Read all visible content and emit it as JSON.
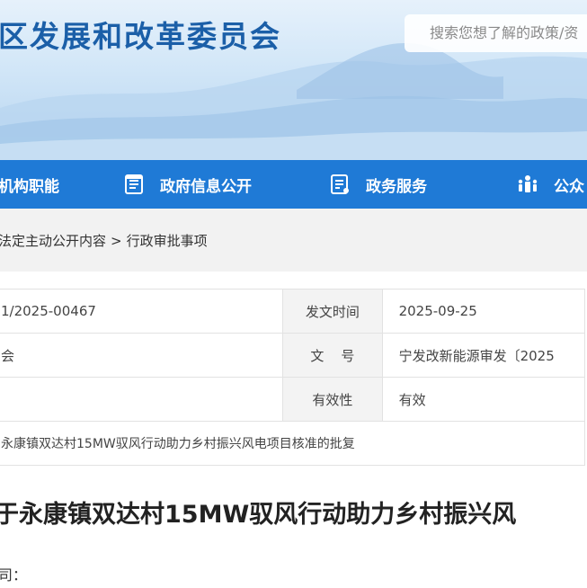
{
  "header": {
    "site_title": "区发展和改革委员会",
    "search_placeholder": "搜索您想了解的政策/资"
  },
  "nav": {
    "items": [
      {
        "label": "机构职能",
        "icon": "building-icon"
      },
      {
        "label": "政府信息公开",
        "icon": "document-list-icon"
      },
      {
        "label": "政务服务",
        "icon": "service-list-icon"
      },
      {
        "label": "公众",
        "icon": "people-icon"
      }
    ]
  },
  "breadcrumb": {
    "items": [
      "法定主动公开内容",
      "行政审批事项"
    ],
    "separator": ">"
  },
  "info": {
    "index_no": "1/2025-00467",
    "publish_date_label": "发文时间",
    "publish_date": "2025-09-25",
    "publisher": "会",
    "doc_no_label": "文    号",
    "doc_no": "宁发改新能源审发〔2025",
    "validity_label": "有效性",
    "validity": "有效",
    "subject": "永康镇双达村15MW驭风行动助力乡村振兴风电项目核准的批复"
  },
  "document": {
    "title": "于永康镇双达村15MW驭风行动助力乡村振兴风",
    "salutation": "司："
  },
  "colors": {
    "nav_bg": "#1f7ad6",
    "title_blue": "#1b5fa8",
    "breadcrumb_bg": "#f2f2f2"
  }
}
